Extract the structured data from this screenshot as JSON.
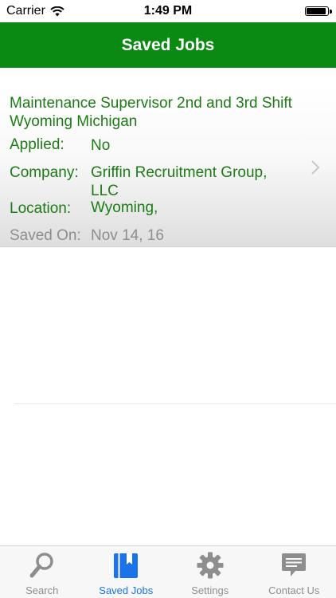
{
  "status_bar": {
    "carrier": "Carrier",
    "time": "1:49 PM",
    "battery_level": 0.95
  },
  "header": {
    "title": "Saved Jobs"
  },
  "job": {
    "title": "Maintenance Supervisor 2nd and 3rd Shift Wyoming Michigan",
    "applied_label": "Applied:",
    "applied_value": "No",
    "company_label": "Company:",
    "company_value": "Griffin Recruitment Group, LLC",
    "location_label": "Location:",
    "location_value": "Wyoming,",
    "saved_label": "Saved On:",
    "saved_value": "Nov 14, 16"
  },
  "tabs": [
    {
      "label": "Search",
      "icon": "search-icon",
      "active": false
    },
    {
      "label": "Saved Jobs",
      "icon": "bookmark-icon",
      "active": true
    },
    {
      "label": "Settings",
      "icon": "gear-icon",
      "active": false
    },
    {
      "label": "Contact Us",
      "icon": "chat-bubble-icon",
      "active": false
    }
  ],
  "colors": {
    "header_bg": "#0a8a12",
    "text_green": "#1d7b16",
    "active_tab": "#1a73e8",
    "inactive_tab": "#8e8e8e"
  }
}
